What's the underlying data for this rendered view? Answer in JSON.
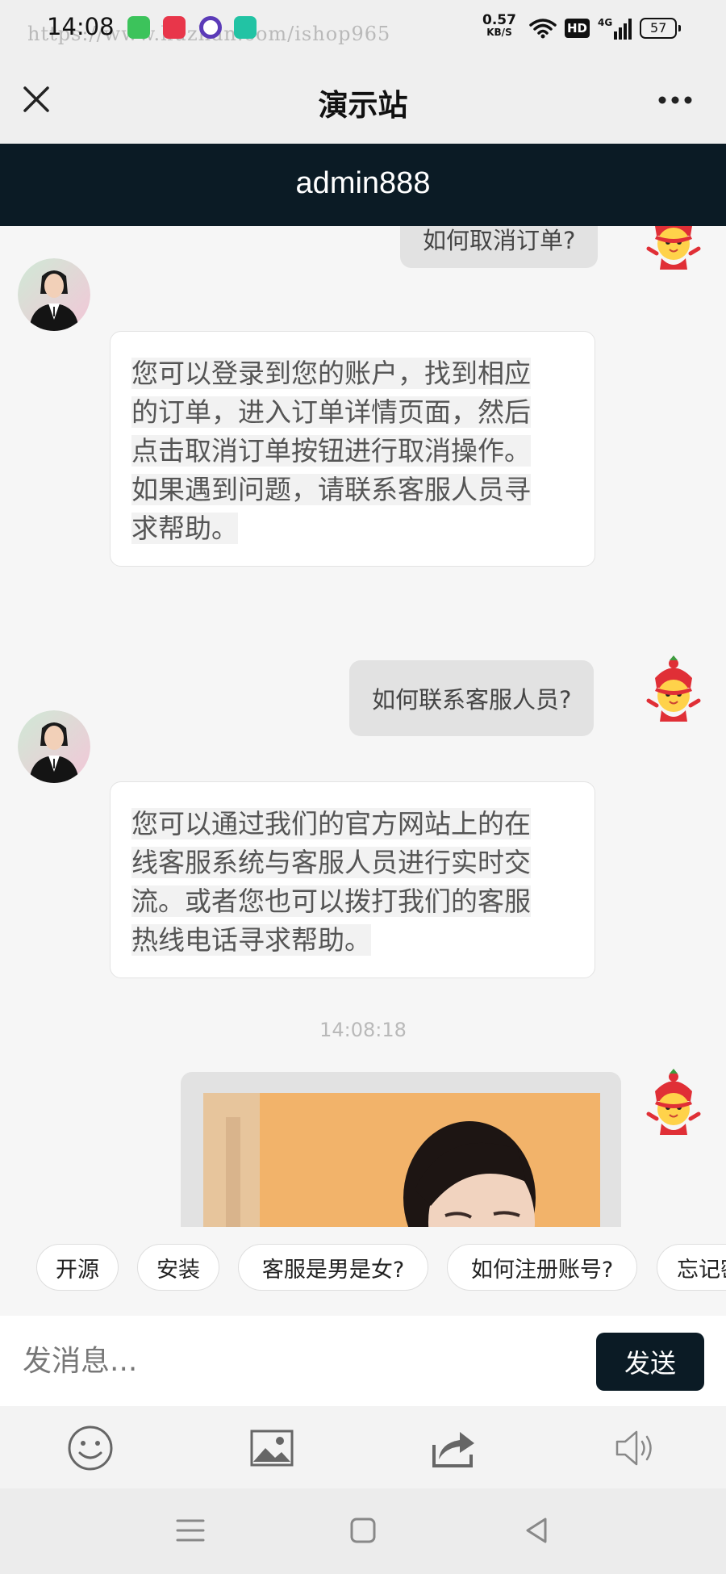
{
  "status_bar": {
    "time": "14:08",
    "watermark": "https://www.huzhan.com/ishop965",
    "net_speed_value": "0.57",
    "net_speed_unit": "KB/S",
    "hd_badge": "HD",
    "network_type": "4G",
    "battery": "57"
  },
  "title_bar": {
    "title": "演示站"
  },
  "chat_header": {
    "title": "admin888"
  },
  "messages": [
    {
      "sender": "user",
      "text": "如何取消订单?"
    },
    {
      "sender": "agent",
      "lines": [
        "您可以登录到您的账户，找到相应",
        "的订单，进入订单详情页面，然后",
        "点击取消订单按钮进行取消操作。",
        "如果遇到问题，请联系客服人员寻",
        "求帮助。"
      ]
    },
    {
      "sender": "user",
      "text": "如何联系客服人员?"
    },
    {
      "sender": "agent",
      "lines": [
        "您可以通过我们的官方网站上的在",
        "线客服系统与客服人员进行实时交",
        "流。或者您也可以拨打我们的客服",
        "热线电话寻求帮助。"
      ]
    },
    {
      "sender": "system",
      "timestamp": "14:08:18"
    },
    {
      "sender": "user",
      "type": "image"
    }
  ],
  "quick_replies": [
    "开源",
    "安装",
    "客服是男是女?",
    "如何注册账号?",
    "忘记密码"
  ],
  "input": {
    "placeholder": "发消息...",
    "value": "",
    "send_label": "发送"
  },
  "toolbar": {
    "icons": [
      "emoji-icon",
      "image-icon",
      "share-icon",
      "speaker-icon"
    ]
  },
  "colors": {
    "header_bg": "#0b1b25",
    "send_button_bg": "#0b1b25",
    "user_bubble_bg": "#e2e2e2",
    "agent_bubble_bg": "#ffffff",
    "page_bg": "#f6f6f6"
  }
}
